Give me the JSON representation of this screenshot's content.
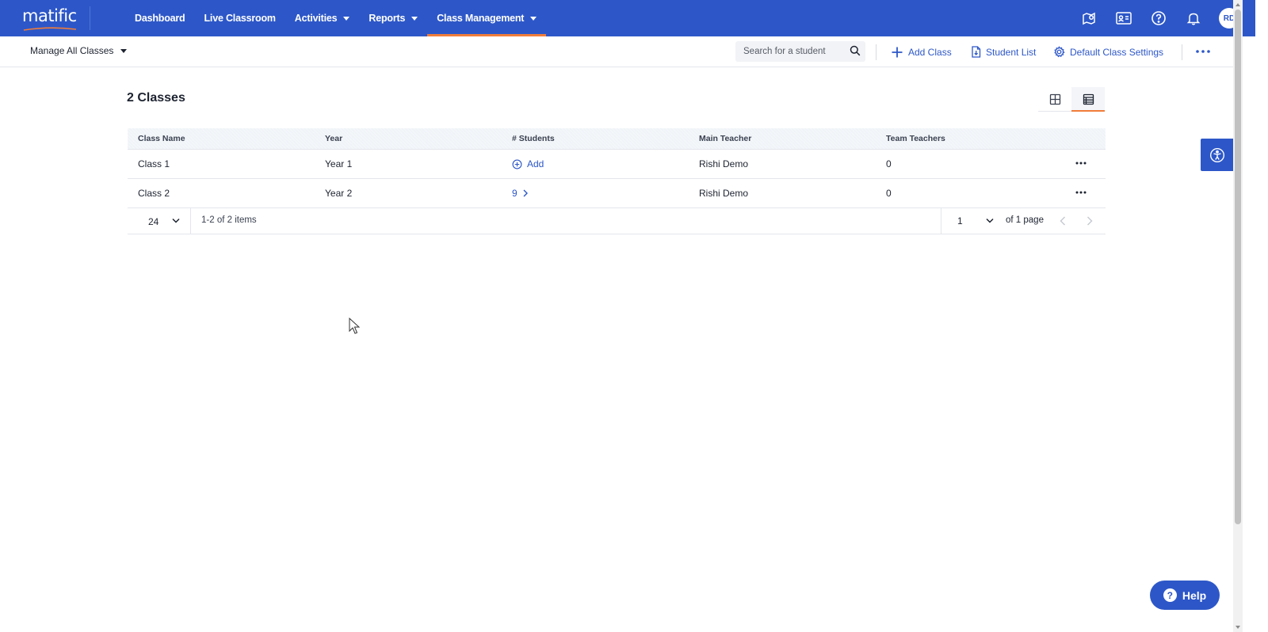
{
  "app": {
    "logo_text": "matific"
  },
  "nav": {
    "items": [
      {
        "label": "Dashboard",
        "dropdown": false,
        "active": false
      },
      {
        "label": "Live Classroom",
        "dropdown": false,
        "active": false
      },
      {
        "label": "Activities",
        "dropdown": true,
        "active": false
      },
      {
        "label": "Reports",
        "dropdown": true,
        "active": false
      },
      {
        "label": "Class Management",
        "dropdown": true,
        "active": true
      }
    ],
    "right_icons": [
      "map-icon",
      "id-card-icon",
      "help-circle-icon",
      "bell-icon"
    ],
    "avatar_initials": "RD"
  },
  "subbar": {
    "manage_label": "Manage All Classes",
    "search_placeholder": "Search for a student",
    "add_class_label": "Add Class",
    "student_list_label": "Student List",
    "default_settings_label": "Default Class Settings"
  },
  "main": {
    "title": "2 Classes",
    "table": {
      "headers": [
        "Class Name",
        "Year",
        "# Students",
        "Main Teacher",
        "Team Teachers"
      ],
      "rows": [
        {
          "class_name": "Class 1",
          "year": "Year 1",
          "students": "Add",
          "students_is_add": true,
          "main_teacher": "Rishi Demo",
          "team_teachers": "0"
        },
        {
          "class_name": "Class 2",
          "year": "Year 2",
          "students": "9",
          "students_is_add": false,
          "main_teacher": "Rishi Demo",
          "team_teachers": "0"
        }
      ]
    },
    "pagination": {
      "page_size": "24",
      "items_text": "1-2 of 2 items",
      "current_page": "1",
      "of_pages_text": "of 1 page"
    }
  },
  "help": {
    "label": "Help"
  },
  "colors": {
    "brand_blue": "#2d57c8",
    "accent_orange": "#f07c3a"
  }
}
